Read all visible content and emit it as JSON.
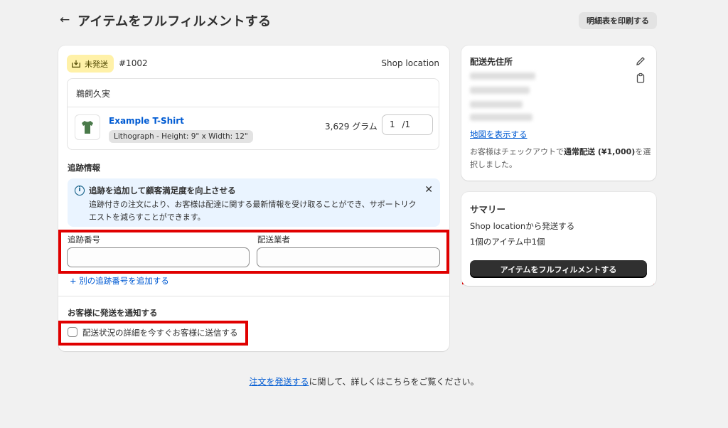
{
  "header": {
    "back_icon": "arrow-left-icon",
    "title": "アイテムをフルフィルメントする",
    "print_label": "明細表を印刷する"
  },
  "order": {
    "status_badge": "未発送",
    "status_color": "#fff1a8",
    "number": "#1002",
    "location": "Shop location",
    "customer": "鵜飼久実",
    "product": {
      "name": "Example T-Shirt",
      "variant": "Lithograph - Height: 9\" x Width: 12\"",
      "weight": "3,629 グラム",
      "qty_value": "1",
      "qty_total": "/1"
    }
  },
  "tracking": {
    "section_title": "追跡情報",
    "banner_title": "追跡を追加して顧客満足度を向上させる",
    "banner_body": "追跡付きの注文により、お客様は配達に関する最新情報を受け取ることができ、サポートリクエストを減らすことができます。",
    "number_label": "追跡番号",
    "carrier_label": "配送業者",
    "number_value": "",
    "carrier_value": "",
    "add_link": "+ 別の追跡番号を追加する"
  },
  "notify": {
    "section_title": "お客様に発送を通知する",
    "checkbox_label": "配送状況の詳細を今すぐお客様に送信する",
    "checked": false
  },
  "address": {
    "title": "配送先住所",
    "map_link": "地図を表示する",
    "note_prefix": "お客様はチェックアウトで",
    "note_bold": "通常配送 (¥1,000)",
    "note_suffix": "を選択しました。"
  },
  "summary": {
    "title": "サマリー",
    "ship_from_bold": "Shop location",
    "ship_from_suffix": "から発送する",
    "items_text": "1個のアイテム中1個",
    "fulfill_button": "アイテムをフルフィルメントする"
  },
  "footer": {
    "link_text": "注文を発送する",
    "suffix": "に関して、詳しくはこちらをご覧ください。"
  },
  "colors": {
    "accent_link": "#005bd3",
    "primary_button": "#303030",
    "highlight_box": "#e00000",
    "info_banner": "#eaf4ff"
  }
}
